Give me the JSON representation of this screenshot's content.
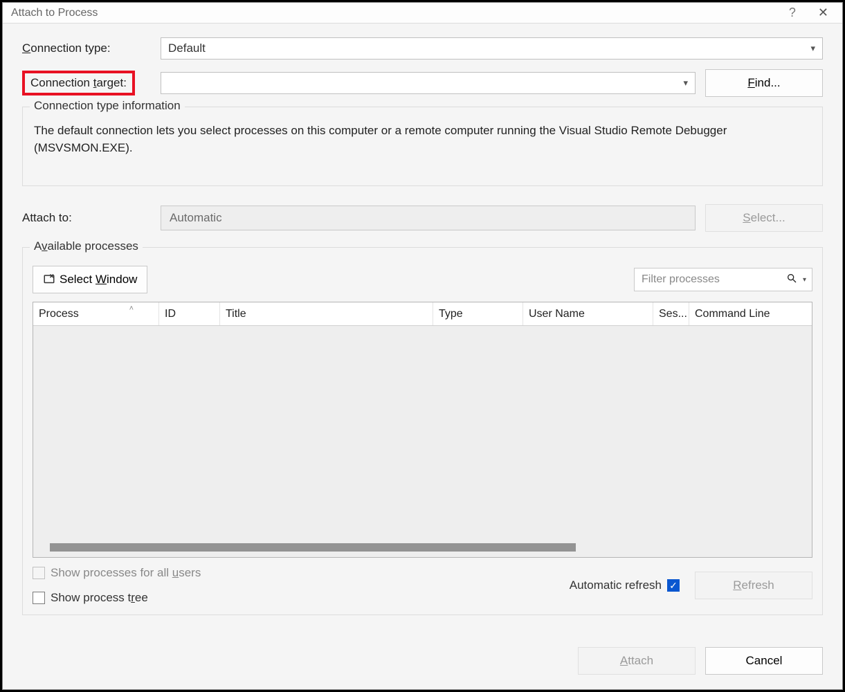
{
  "window": {
    "title": "Attach to Process",
    "help_symbol": "?",
    "close_symbol": "✕"
  },
  "connection_type": {
    "label_pre": "",
    "label": "Connection type:",
    "access_char": "C",
    "label_rest": "onnection type:",
    "value": "Default"
  },
  "connection_target": {
    "label_pre": "Connection ",
    "access_char": "t",
    "label_rest": "arget:",
    "value": "",
    "find_pre": "",
    "find_access": "F",
    "find_rest": "ind..."
  },
  "info": {
    "legend": "Connection type information",
    "text": "The default connection lets you select processes on this computer or a remote computer running the Visual Studio Remote Debugger (MSVSMON.EXE)."
  },
  "attach_to": {
    "label": "Attach to:",
    "value": "Automatic",
    "select_pre": "",
    "select_access": "S",
    "select_rest": "elect..."
  },
  "available": {
    "legend_pre": "A",
    "legend_access": "v",
    "legend_rest": "ailable processes",
    "select_window_pre": "Select ",
    "select_window_access": "W",
    "select_window_rest": "indow",
    "filter_placeholder": "Filter processes",
    "columns": {
      "process": "Process",
      "id": "ID",
      "title": "Title",
      "type": "Type",
      "user": "User Name",
      "sess": "Ses...",
      "cmd": "Command Line"
    }
  },
  "options": {
    "show_all_users_pre": "Show processes for all ",
    "show_all_users_access": "u",
    "show_all_users_rest": "sers",
    "show_tree_pre": "Show process t",
    "show_tree_access": "r",
    "show_tree_rest": "ee",
    "auto_refresh": "Automatic refresh",
    "refresh_pre": "",
    "refresh_access": "R",
    "refresh_rest": "efresh"
  },
  "footer": {
    "attach_pre": "",
    "attach_access": "A",
    "attach_rest": "ttach",
    "cancel": "Cancel"
  }
}
